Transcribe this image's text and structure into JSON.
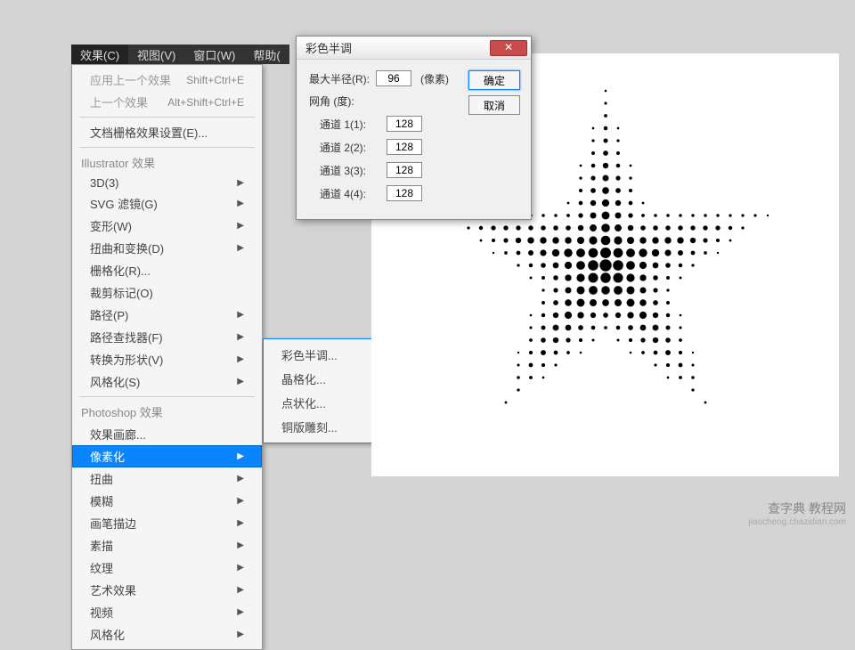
{
  "menubar": {
    "items": [
      "效果(C)",
      "视图(V)",
      "窗口(W)",
      "帮助("
    ]
  },
  "dropdown": {
    "applyLast": {
      "label": "应用上一个效果",
      "shortcut": "Shift+Ctrl+E"
    },
    "last": {
      "label": "上一个效果",
      "shortcut": "Alt+Shift+Ctrl+E"
    },
    "docRaster": "文档栅格效果设置(E)...",
    "ilHeader": "Illustrator 效果",
    "il": {
      "threeD": "3D(3)",
      "svg": "SVG 滤镜(G)",
      "warp": "变形(W)",
      "distort": "扭曲和变换(D)",
      "rasterize": "栅格化(R)...",
      "cropMarks": "裁剪标记(O)",
      "path": "路径(P)",
      "pathfinder": "路径查找器(F)",
      "convert": "转换为形状(V)",
      "stylize": "风格化(S)"
    },
    "psHeader": "Photoshop 效果",
    "ps": {
      "gallery": "效果画廊...",
      "pixelate": "像素化",
      "distort": "扭曲",
      "blur": "模糊",
      "brush": "画笔描边",
      "sketch": "素描",
      "texture": "纹理",
      "artistic": "艺术效果",
      "video": "视频",
      "stylize": "风格化"
    }
  },
  "submenu": {
    "colorHalftone": "彩色半调...",
    "crystallize": "晶格化...",
    "pointillize": "点状化...",
    "mezzotint": "铜版雕刻..."
  },
  "dialog": {
    "title": "彩色半调",
    "maxRadius": {
      "label": "最大半径(R):",
      "value": "96",
      "unit": "(像素)"
    },
    "screenAngle": "网角 (度):",
    "ch1": {
      "label": "通道 1(1):",
      "value": "128"
    },
    "ch2": {
      "label": "通道 2(2):",
      "value": "128"
    },
    "ch3": {
      "label": "通道 3(3):",
      "value": "128"
    },
    "ch4": {
      "label": "通道 4(4):",
      "value": "128"
    },
    "ok": "确定",
    "cancel": "取消"
  },
  "watermark": {
    "main": "查字典 教程网",
    "sub": "jiaocheng.chazidian.com"
  }
}
